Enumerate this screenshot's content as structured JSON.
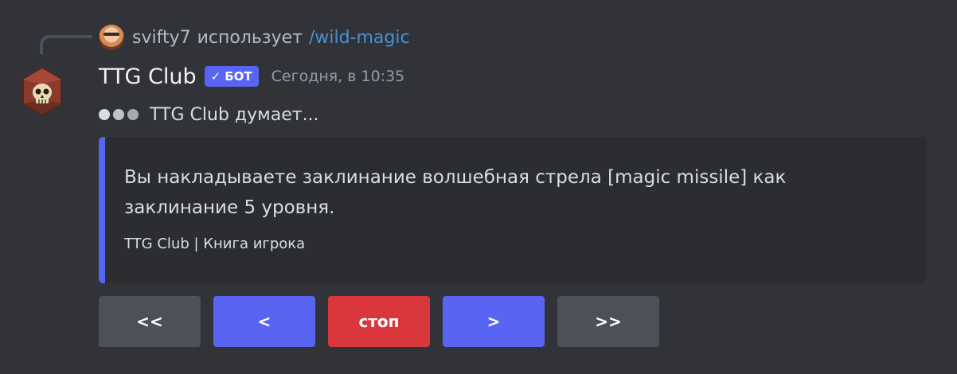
{
  "reply": {
    "username": "svifty7",
    "action": "использует",
    "command": "/wild-magic"
  },
  "message": {
    "author": "TTG Club",
    "bot_tag": "БОТ",
    "bot_tag_icon": "check-icon",
    "timestamp": "Сегодня, в 10:35",
    "thinking": "TTG Club думает..."
  },
  "embed": {
    "accent_color": "#5865f2",
    "description": "Вы накладываете заклинание волшебная стрела [magic missile] как заклинание 5 уровня.",
    "footer": "TTG Club | Книга игрока"
  },
  "buttons": [
    {
      "label": "<<",
      "style": "secondary"
    },
    {
      "label": "<",
      "style": "primary"
    },
    {
      "label": "стоп",
      "style": "danger"
    },
    {
      "label": ">",
      "style": "primary"
    },
    {
      "label": ">>",
      "style": "secondary"
    }
  ],
  "colors": {
    "background": "#313338",
    "embed_bg": "#2b2d31",
    "blurple": "#5865f2",
    "danger": "#da373c",
    "secondary": "#4e5058",
    "link": "#4a8fd0"
  }
}
